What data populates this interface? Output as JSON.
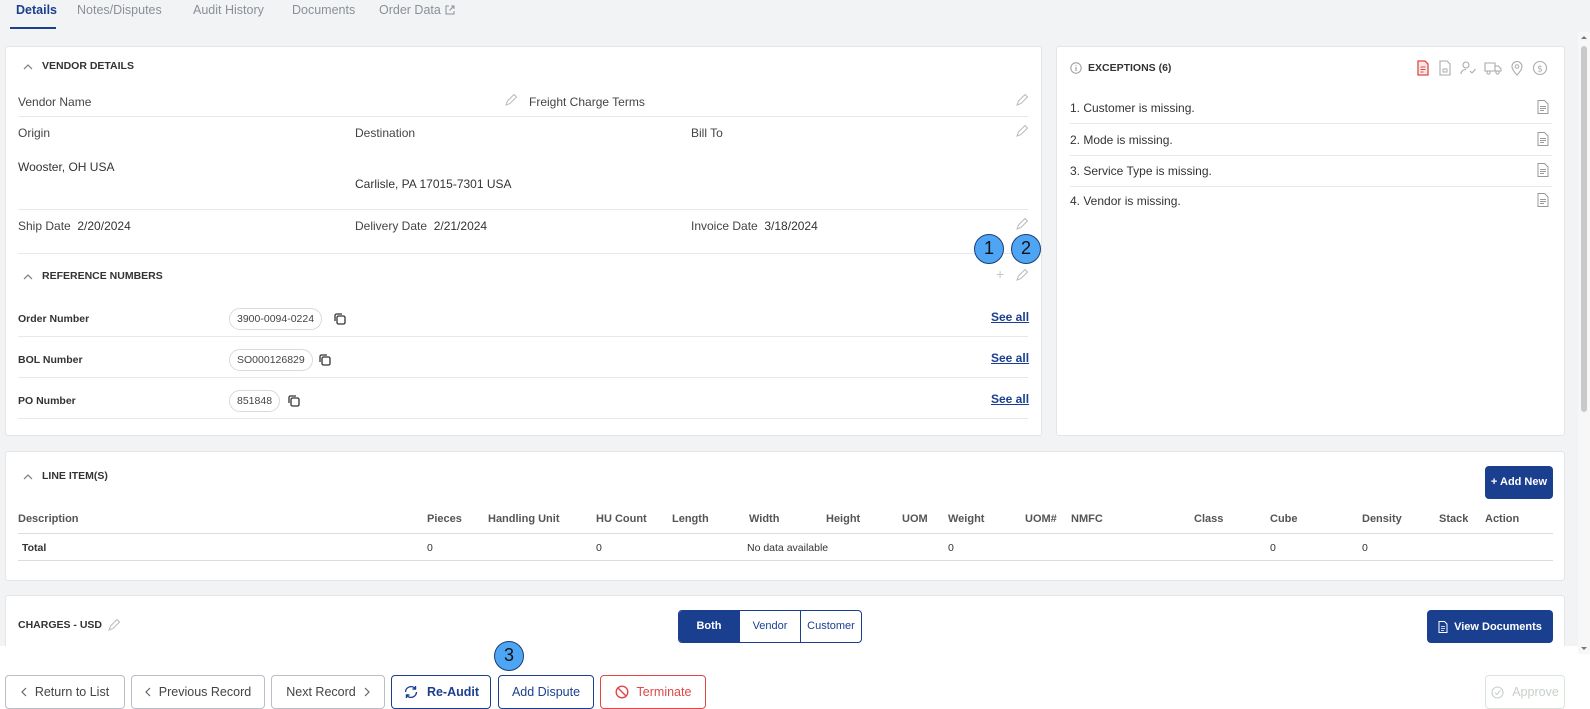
{
  "tabs": [
    {
      "label": "Details"
    },
    {
      "label": "Notes/Disputes"
    },
    {
      "label": "Audit History"
    },
    {
      "label": "Documents"
    },
    {
      "label": "Order Data"
    }
  ],
  "vendor": {
    "title": "VENDOR DETAILS",
    "vendor_name_label": "Vendor Name",
    "freight_terms_label": "Freight Charge Terms",
    "origin_label": "Origin",
    "destination_label": "Destination",
    "bill_to_label": "Bill To",
    "origin_value": "Wooster, OH USA",
    "destination_value": "Carlisle, PA 17015-7301 USA",
    "ship_date_label": "Ship Date",
    "ship_date": "2/20/2024",
    "delivery_date_label": "Delivery Date",
    "delivery_date": "2/21/2024",
    "invoice_date_label": "Invoice Date",
    "invoice_date": "3/18/2024"
  },
  "reference": {
    "title": "REFERENCE NUMBERS",
    "add_symbol": "+",
    "rows": [
      {
        "label": "Order Number",
        "value": "3900-0094-0224",
        "link": "See all"
      },
      {
        "label": "BOL Number",
        "value": "SO000126829",
        "link": "See all"
      },
      {
        "label": "PO Number",
        "value": "851848",
        "link": "See all"
      }
    ]
  },
  "exceptions": {
    "title": "EXCEPTIONS (6)",
    "items": [
      "1. Customer is missing.",
      "2. Mode is missing.",
      "3. Service Type is missing.",
      "4. Vendor is missing."
    ],
    "filter_icons": [
      "document-icon",
      "file-icon",
      "person-check-icon",
      "truck-icon",
      "location-pin-icon",
      "dollar-icon"
    ],
    "active_color": "#e04848"
  },
  "markers": [
    "1",
    "2",
    "3"
  ],
  "line_items": {
    "title": "LINE ITEM(S)",
    "add_button": "+ Add New",
    "columns": [
      "Description",
      "Pieces",
      "Handling Unit",
      "HU Count",
      "Length",
      "Width",
      "Height",
      "UOM",
      "Weight",
      "UOM#",
      "NMFC",
      "Class",
      "Cube",
      "Density",
      "Stack",
      "Action"
    ],
    "total": {
      "description": "Total",
      "pieces": "0",
      "hu_count": "0",
      "no_data": "No data available",
      "weight": "0",
      "cube": "0",
      "density": "0"
    }
  },
  "charges": {
    "title": "CHARGES - USD",
    "toggle": [
      "Both",
      "Vendor",
      "Customer"
    ],
    "view_documents": "View Documents"
  },
  "footer": {
    "return": "Return to List",
    "previous": "Previous Record",
    "next": "Next Record",
    "reaudit": "Re-Audit",
    "dispute": "Add Dispute",
    "terminate": "Terminate",
    "approve": "Approve"
  },
  "colors": {
    "primary": "#1b3f8f",
    "danger": "#e04848",
    "marker": "#4ea5f4"
  }
}
